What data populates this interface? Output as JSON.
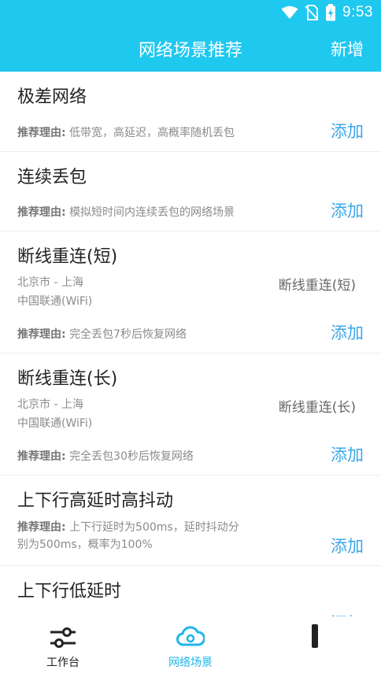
{
  "status": {
    "time": "9:53"
  },
  "appbar": {
    "title": "网络场景推荐",
    "action": "新增"
  },
  "reason_label": "推荐理由:",
  "cards": [
    {
      "title": "极差网络",
      "reason": "低带宽，高延迟，高概率随机丢包",
      "add": "添加"
    },
    {
      "title": "连续丢包",
      "reason": "模拟短时间内连续丢包的网络场景",
      "add": "添加"
    },
    {
      "title": "断线重连(短)",
      "location": "北京市 - 上海",
      "carrier": "中国联通(WiFi)",
      "tag": "断线重连(短)",
      "reason": "完全丢包7秒后恢复网络",
      "add": "添加"
    },
    {
      "title": "断线重连(长)",
      "location": "北京市 - 上海",
      "carrier": "中国联通(WiFi)",
      "tag": "断线重连(长)",
      "reason": "完全丢包30秒后恢复网络",
      "add": "添加"
    },
    {
      "title": "上下行高延时高抖动",
      "reason_line1": "上下行延时为500ms，延时抖动分",
      "reason_line2": "别为500ms，概率为100%",
      "add": "添加"
    },
    {
      "title": "上下行低延时",
      "add": "添加"
    }
  ],
  "tabs": [
    {
      "label": "工作台",
      "icon": "sliders-icon",
      "color": "#222222"
    },
    {
      "label": "网络场景",
      "icon": "cloud-icon",
      "color": "#1fb6e8"
    },
    {
      "label": "",
      "icon": "user-icon",
      "color": "#222222"
    }
  ],
  "colors": {
    "primary": "#1fc8ee",
    "link": "#3aa7e8"
  }
}
